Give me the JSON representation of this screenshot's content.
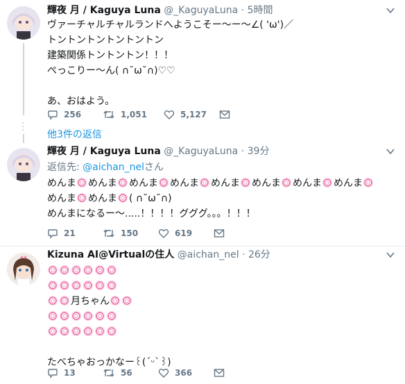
{
  "tweets": [
    {
      "name": "輝夜 月 / Kaguya Luna",
      "handle": "@_KaguyaLuna",
      "time": "5時間",
      "lines": [
        "ヴァーチャルチャルランドへようこそー〜ー〜∠( 'ω')／",
        "トントントントントントン",
        "建築関係トントントン！！！",
        "ぺっこりー〜ん( ∩˘ω˘∩)♡♡",
        "",
        "あ、おはよう。"
      ],
      "replies": "256",
      "retweets": "1,051",
      "likes": "5,127"
    },
    {
      "name": "輝夜 月 / Kaguya Luna",
      "handle": "@_KaguyaLuna",
      "time": "39分",
      "reply_prefix": "返信先: ",
      "reply_link": "@aichan_nel",
      "reply_suffix": "さん",
      "line_a_word": "めんま",
      "line_b_tail": "( ∩˘ω˘∩)",
      "line_c": "めんまになるー〜.....！！！！グググ。。。！！！",
      "replies": "21",
      "retweets": "150",
      "likes": "619"
    },
    {
      "name": "Kizuna AI@Virtualの住人",
      "handle": "@aichan_nel",
      "time": "26分",
      "moon_text": "月ちゃん",
      "last_line": "たべちゃおっかなー꒰(´ᵕ`꒱)",
      "replies": "13",
      "retweets": "56",
      "likes": "366"
    }
  ],
  "thread": {
    "more_replies": "他3件の返信"
  },
  "dot_sep": "·",
  "icons": [
    "reply-icon",
    "retweet-icon",
    "like-icon",
    "dm-icon",
    "caret-down-icon",
    "menma-swirl-icon"
  ],
  "colors": {
    "link": "#1b95e0",
    "muted": "#657786",
    "line": "#ccd6dd",
    "swirl": "#e86aa5"
  }
}
